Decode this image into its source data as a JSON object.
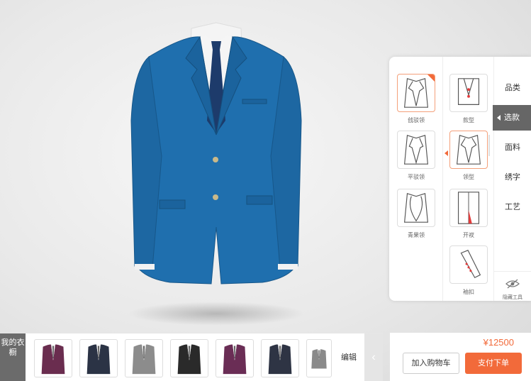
{
  "left_options": [
    {
      "label": "戗驳领",
      "icon": "peak-lapel-icon",
      "selected": true
    },
    {
      "label": "平驳领",
      "icon": "notch-lapel-icon",
      "selected": false
    },
    {
      "label": "青果领",
      "icon": "shawl-lapel-icon",
      "selected": false
    }
  ],
  "right_options": [
    {
      "label": "款型",
      "icon": "jacket-style-icon"
    },
    {
      "label": "领型",
      "icon": "lapel-type-icon"
    },
    {
      "label": "开衩",
      "icon": "vent-icon"
    },
    {
      "label": "袖扣",
      "icon": "sleeve-button-icon"
    }
  ],
  "nav": [
    "品类",
    "选款",
    "面料",
    "绣字",
    "工艺"
  ],
  "nav_active_index": 1,
  "hide_tool_label": "隐藏工具",
  "wardrobe": {
    "label": "我的衣橱",
    "edit_label": "编辑",
    "collapse_icon": "chevron-left-icon",
    "items": [
      {
        "name": "purple-suit",
        "color": "#6a2d4f"
      },
      {
        "name": "navy-double-breasted-suit",
        "color": "#2b3345"
      },
      {
        "name": "grey-double-breasted-suit",
        "color": "#8c8c8c"
      },
      {
        "name": "black-suit",
        "color": "#2a2a2a"
      },
      {
        "name": "purple-suit-2",
        "color": "#6a2d55"
      },
      {
        "name": "navy-double-breasted-suit-2",
        "color": "#2e3444"
      },
      {
        "name": "grey-suit-partial",
        "color": "#8a8a8a"
      }
    ]
  },
  "checkout": {
    "price": "¥12500",
    "add_to_cart": "加入购物车",
    "pay": "支付下单"
  },
  "colors": {
    "accent": "#f26a3a",
    "suit_blue": "#1f6fae",
    "nav_active": "#666666"
  }
}
